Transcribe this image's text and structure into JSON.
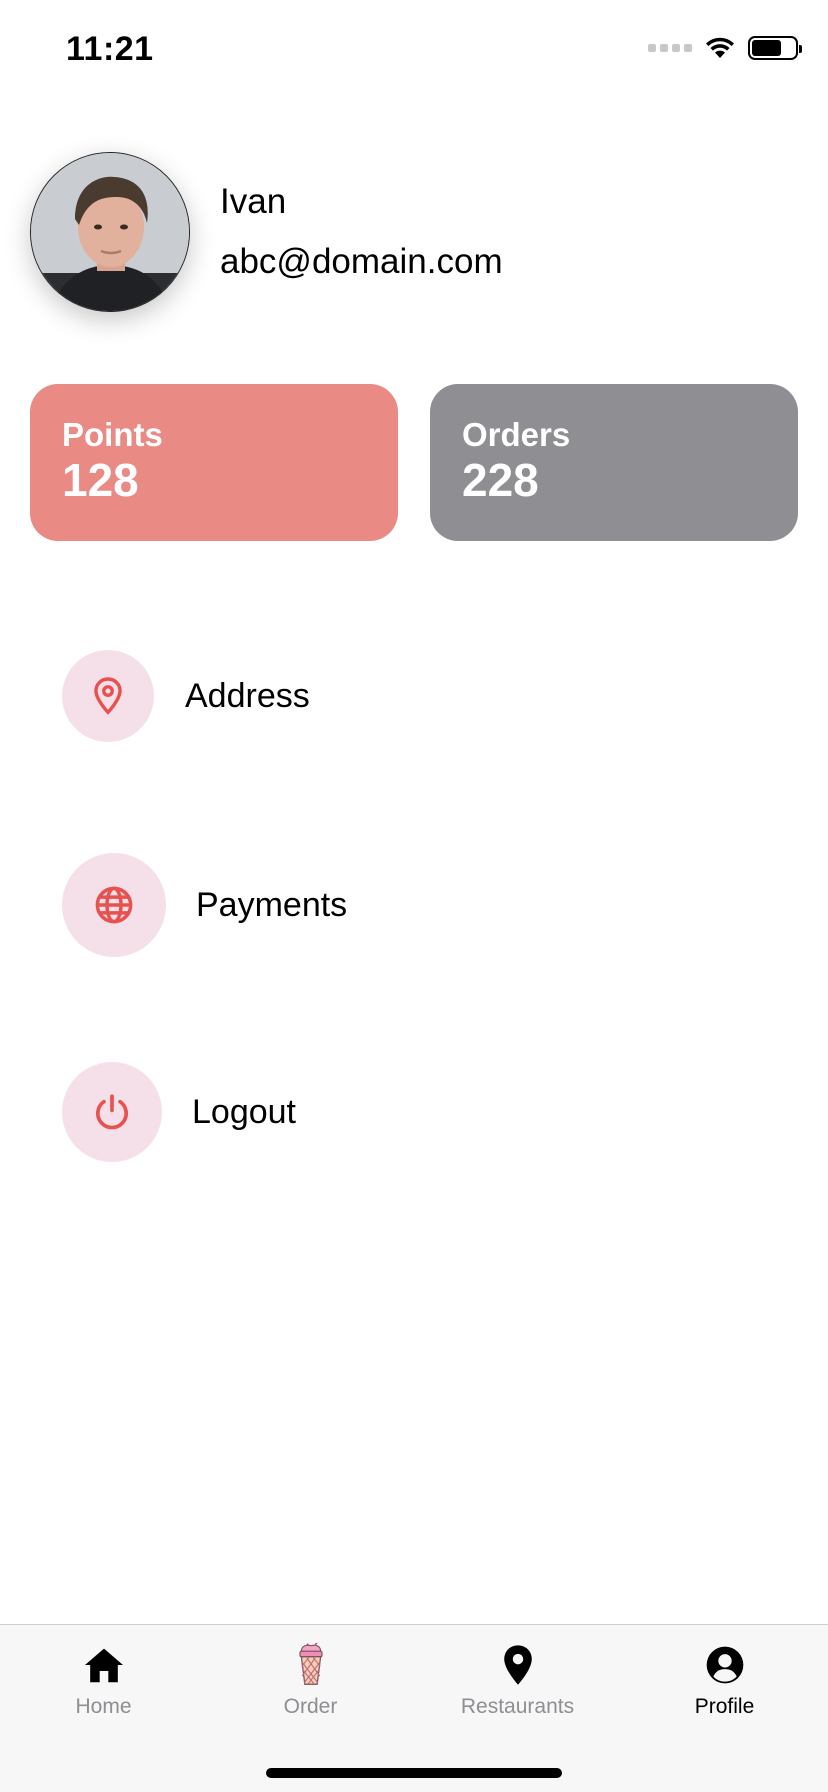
{
  "status_bar": {
    "time": "11:21"
  },
  "profile": {
    "name": "Ivan",
    "email": "abc@domain.com"
  },
  "stats": [
    {
      "label": "Points",
      "value": "128",
      "color": "#e98a85"
    },
    {
      "label": "Orders",
      "value": "228",
      "color": "#8e8e93"
    }
  ],
  "menu": [
    {
      "label": "Address",
      "icon": "map-pin-icon"
    },
    {
      "label": "Payments",
      "icon": "globe-icon"
    },
    {
      "label": "Logout",
      "icon": "power-icon"
    }
  ],
  "accent_color": "#e8524e",
  "tabs": [
    {
      "label": "Home",
      "icon": "home-icon",
      "active": false
    },
    {
      "label": "Order",
      "icon": "ice-cream-icon",
      "active": false
    },
    {
      "label": "Restaurants",
      "icon": "location-pin-icon",
      "active": false
    },
    {
      "label": "Profile",
      "icon": "user-circle-icon",
      "active": true
    }
  ]
}
